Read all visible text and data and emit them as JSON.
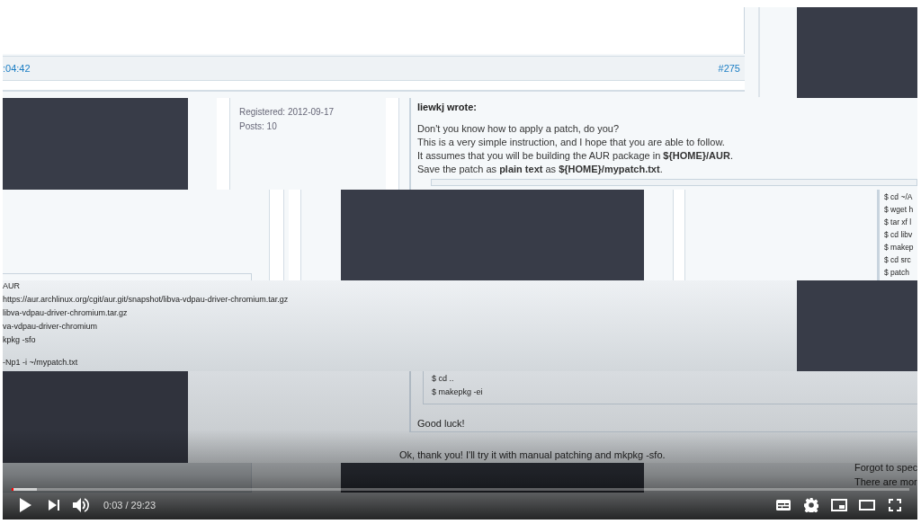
{
  "video_frame": {
    "post_time": ":04:42",
    "post_number": "#275",
    "user_info": [
      "Registered: 2012-09-17",
      "Posts: 10"
    ],
    "quote_author": "liewkj wrote:",
    "quote_lines": [
      "Don't you know how to apply a patch, do you?",
      "This is a very simple instruction, and I hope that you are able to follow.",
      "It assumes that you will be building the AUR package in **${HOME}/AUR**.",
      "Save the patch as **plain text** as **${HOME}/mypatch.txt**."
    ],
    "code_right": [
      "$ cd ~/A",
      "$ wget h",
      "$ tar xf l",
      "$ cd libv",
      "$ makep",
      "$ cd src",
      "$ patch"
    ],
    "code_left": [
      "AUR",
      "https://aur.archlinux.org/cgit/aur.git/snapshot/libva-vdpau-driver-chromium.tar.gz",
      "libva-vdpau-driver-chromium.tar.gz",
      "va-vdpau-driver-chromium",
      "kpkg -sfo"
    ],
    "code_left_after_blank": "-Np1 -i ~/mypatch.txt",
    "code_end": [
      "$ cd ..",
      "$ makepkg -ei"
    ],
    "quote_closing": "Good luck!",
    "reply": "Ok, thank you! I'll try it with manual patching and mkpkg -sfo.",
    "next_post": [
      "Forgot to spec",
      "There are mor"
    ]
  },
  "player": {
    "progress": {
      "level": 0.0017
    },
    "time": "0:03 / 29:23"
  }
}
